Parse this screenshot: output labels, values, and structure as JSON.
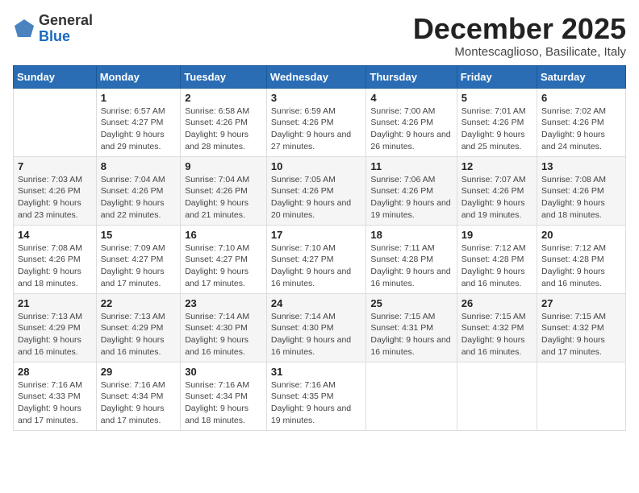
{
  "logo": {
    "general": "General",
    "blue": "Blue"
  },
  "title": "December 2025",
  "subtitle": "Montescaglioso, Basilicate, Italy",
  "days_of_week": [
    "Sunday",
    "Monday",
    "Tuesday",
    "Wednesday",
    "Thursday",
    "Friday",
    "Saturday"
  ],
  "weeks": [
    [
      {
        "day": "",
        "info": ""
      },
      {
        "day": "1",
        "info": "Sunrise: 6:57 AM\nSunset: 4:27 PM\nDaylight: 9 hours\nand 29 minutes."
      },
      {
        "day": "2",
        "info": "Sunrise: 6:58 AM\nSunset: 4:26 PM\nDaylight: 9 hours\nand 28 minutes."
      },
      {
        "day": "3",
        "info": "Sunrise: 6:59 AM\nSunset: 4:26 PM\nDaylight: 9 hours\nand 27 minutes."
      },
      {
        "day": "4",
        "info": "Sunrise: 7:00 AM\nSunset: 4:26 PM\nDaylight: 9 hours\nand 26 minutes."
      },
      {
        "day": "5",
        "info": "Sunrise: 7:01 AM\nSunset: 4:26 PM\nDaylight: 9 hours\nand 25 minutes."
      },
      {
        "day": "6",
        "info": "Sunrise: 7:02 AM\nSunset: 4:26 PM\nDaylight: 9 hours\nand 24 minutes."
      }
    ],
    [
      {
        "day": "7",
        "info": "Sunrise: 7:03 AM\nSunset: 4:26 PM\nDaylight: 9 hours\nand 23 minutes."
      },
      {
        "day": "8",
        "info": "Sunrise: 7:04 AM\nSunset: 4:26 PM\nDaylight: 9 hours\nand 22 minutes."
      },
      {
        "day": "9",
        "info": "Sunrise: 7:04 AM\nSunset: 4:26 PM\nDaylight: 9 hours\nand 21 minutes."
      },
      {
        "day": "10",
        "info": "Sunrise: 7:05 AM\nSunset: 4:26 PM\nDaylight: 9 hours\nand 20 minutes."
      },
      {
        "day": "11",
        "info": "Sunrise: 7:06 AM\nSunset: 4:26 PM\nDaylight: 9 hours\nand 19 minutes."
      },
      {
        "day": "12",
        "info": "Sunrise: 7:07 AM\nSunset: 4:26 PM\nDaylight: 9 hours\nand 19 minutes."
      },
      {
        "day": "13",
        "info": "Sunrise: 7:08 AM\nSunset: 4:26 PM\nDaylight: 9 hours\nand 18 minutes."
      }
    ],
    [
      {
        "day": "14",
        "info": "Sunrise: 7:08 AM\nSunset: 4:26 PM\nDaylight: 9 hours\nand 18 minutes."
      },
      {
        "day": "15",
        "info": "Sunrise: 7:09 AM\nSunset: 4:27 PM\nDaylight: 9 hours\nand 17 minutes."
      },
      {
        "day": "16",
        "info": "Sunrise: 7:10 AM\nSunset: 4:27 PM\nDaylight: 9 hours\nand 17 minutes."
      },
      {
        "day": "17",
        "info": "Sunrise: 7:10 AM\nSunset: 4:27 PM\nDaylight: 9 hours\nand 16 minutes."
      },
      {
        "day": "18",
        "info": "Sunrise: 7:11 AM\nSunset: 4:28 PM\nDaylight: 9 hours\nand 16 minutes."
      },
      {
        "day": "19",
        "info": "Sunrise: 7:12 AM\nSunset: 4:28 PM\nDaylight: 9 hours\nand 16 minutes."
      },
      {
        "day": "20",
        "info": "Sunrise: 7:12 AM\nSunset: 4:28 PM\nDaylight: 9 hours\nand 16 minutes."
      }
    ],
    [
      {
        "day": "21",
        "info": "Sunrise: 7:13 AM\nSunset: 4:29 PM\nDaylight: 9 hours\nand 16 minutes."
      },
      {
        "day": "22",
        "info": "Sunrise: 7:13 AM\nSunset: 4:29 PM\nDaylight: 9 hours\nand 16 minutes."
      },
      {
        "day": "23",
        "info": "Sunrise: 7:14 AM\nSunset: 4:30 PM\nDaylight: 9 hours\nand 16 minutes."
      },
      {
        "day": "24",
        "info": "Sunrise: 7:14 AM\nSunset: 4:30 PM\nDaylight: 9 hours\nand 16 minutes."
      },
      {
        "day": "25",
        "info": "Sunrise: 7:15 AM\nSunset: 4:31 PM\nDaylight: 9 hours\nand 16 minutes."
      },
      {
        "day": "26",
        "info": "Sunrise: 7:15 AM\nSunset: 4:32 PM\nDaylight: 9 hours\nand 16 minutes."
      },
      {
        "day": "27",
        "info": "Sunrise: 7:15 AM\nSunset: 4:32 PM\nDaylight: 9 hours\nand 17 minutes."
      }
    ],
    [
      {
        "day": "28",
        "info": "Sunrise: 7:16 AM\nSunset: 4:33 PM\nDaylight: 9 hours\nand 17 minutes."
      },
      {
        "day": "29",
        "info": "Sunrise: 7:16 AM\nSunset: 4:34 PM\nDaylight: 9 hours\nand 17 minutes."
      },
      {
        "day": "30",
        "info": "Sunrise: 7:16 AM\nSunset: 4:34 PM\nDaylight: 9 hours\nand 18 minutes."
      },
      {
        "day": "31",
        "info": "Sunrise: 7:16 AM\nSunset: 4:35 PM\nDaylight: 9 hours\nand 19 minutes."
      },
      {
        "day": "",
        "info": ""
      },
      {
        "day": "",
        "info": ""
      },
      {
        "day": "",
        "info": ""
      }
    ]
  ]
}
